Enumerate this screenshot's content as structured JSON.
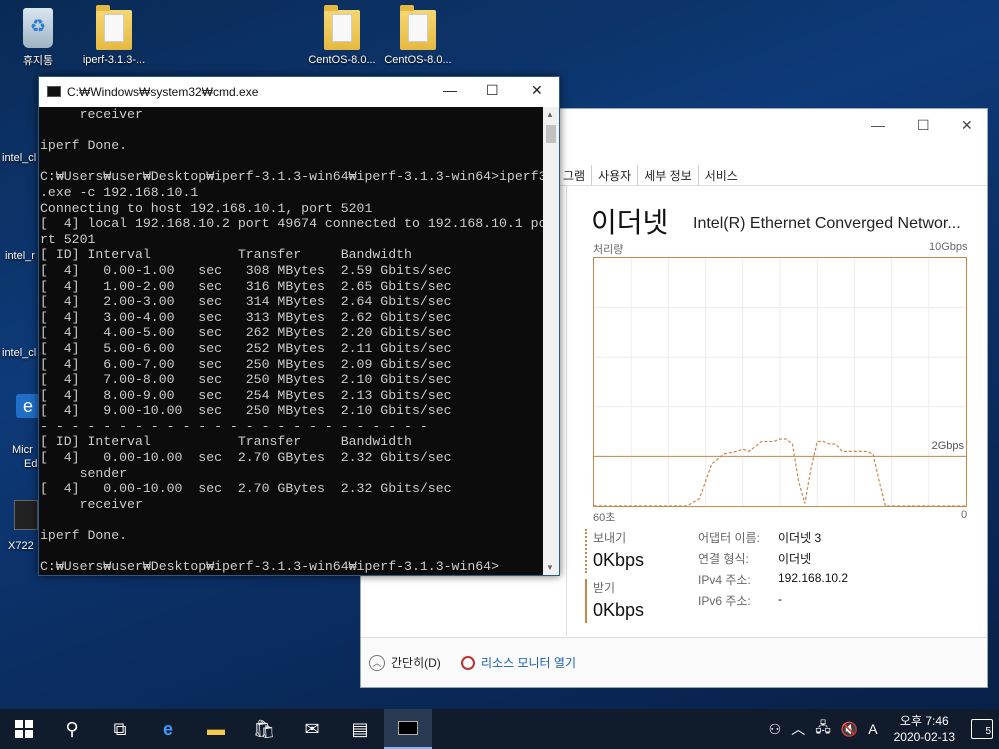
{
  "desktop": {
    "icons": [
      {
        "label": "휴지통"
      },
      {
        "label": "iperf-3.1.3-..."
      },
      {
        "label": "CentOS-8.0..."
      },
      {
        "label": "CentOS-8.0..."
      }
    ],
    "partial_labels": [
      "intel_cl",
      "intel_r",
      "intel_cl",
      "Micr",
      "Ed",
      "X722"
    ]
  },
  "cmd": {
    "title": "C:₩Windows₩system32₩cmd.exe",
    "lines": [
      "     receiver",
      "",
      "iperf Done.",
      "",
      "C:₩Users₩user₩Desktop₩iperf-3.1.3-win64₩iperf-3.1.3-win64>iperf3",
      ".exe -c 192.168.10.1",
      "Connecting to host 192.168.10.1, port 5201",
      "[  4] local 192.168.10.2 port 49674 connected to 192.168.10.1 po",
      "rt 5201",
      "[ ID] Interval           Transfer     Bandwidth",
      "[  4]   0.00-1.00   sec   308 MBytes  2.59 Gbits/sec",
      "[  4]   1.00-2.00   sec   316 MBytes  2.65 Gbits/sec",
      "[  4]   2.00-3.00   sec   314 MBytes  2.64 Gbits/sec",
      "[  4]   3.00-4.00   sec   313 MBytes  2.62 Gbits/sec",
      "[  4]   4.00-5.00   sec   262 MBytes  2.20 Gbits/sec",
      "[  4]   5.00-6.00   sec   252 MBytes  2.11 Gbits/sec",
      "[  4]   6.00-7.00   sec   250 MBytes  2.09 Gbits/sec",
      "[  4]   7.00-8.00   sec   250 MBytes  2.10 Gbits/sec",
      "[  4]   8.00-9.00   sec   254 MBytes  2.13 Gbits/sec",
      "[  4]   9.00-10.00  sec   250 MBytes  2.10 Gbits/sec",
      "- - - - - - - - - - - - - - - - - - - - - - - - -",
      "[ ID] Interval           Transfer     Bandwidth",
      "[  4]   0.00-10.00  sec  2.70 GBytes  2.32 Gbits/sec",
      "     sender",
      "[  4]   0.00-10.00  sec  2.70 GBytes  2.32 Gbits/sec",
      "     receiver",
      "",
      "iperf Done.",
      "",
      "C:₩Users₩user₩Desktop₩iperf-3.1.3-win64₩iperf-3.1.3-win64>"
    ]
  },
  "taskmgr": {
    "tabs": [
      "그램",
      "사용자",
      "세부 정보",
      "서비스"
    ],
    "heading": "이더넷",
    "adapter": "Intel(R) Ethernet Converged Networ...",
    "throughput_label": "처리량",
    "max_label": "10Gbps",
    "mid_label": "2Gbps",
    "x_left": "60초",
    "x_right": "0",
    "send_label": "보내기",
    "send_value": "0Kbps",
    "recv_label": "받기",
    "recv_value": "0Kbps",
    "info": [
      {
        "k": "어댑터 이름:",
        "v": "이더넷 3"
      },
      {
        "k": "연결 형식:",
        "v": "이더넷"
      },
      {
        "k": "IPv4 주소:",
        "v": "192.168.10.2"
      },
      {
        "k": "IPv6 주소:",
        "v": "-"
      }
    ],
    "footer_simple": "간단히(D)",
    "footer_resmon": "리소스 모니터 열기"
  },
  "chart_data": {
    "type": "line",
    "ylim": [
      0,
      10
    ],
    "x": [
      60,
      50,
      45,
      43,
      41,
      39,
      37,
      36,
      35,
      34,
      33,
      32,
      31,
      30,
      29,
      28,
      27,
      26,
      25,
      24,
      23,
      22,
      21,
      20,
      19,
      18,
      17,
      16,
      15,
      14,
      13,
      12,
      11,
      10,
      0
    ],
    "series": [
      {
        "values": [
          0,
          0,
          0,
          0.3,
          1.7,
          2.1,
          2.2,
          2.3,
          2.2,
          2.4,
          2.6,
          2.6,
          2.6,
          2.7,
          2.7,
          2.5,
          1.0,
          0.1,
          1.5,
          2.6,
          2.6,
          2.5,
          2.5,
          2.2,
          2.2,
          2.2,
          2.2,
          2.2,
          2.1,
          1.0,
          0,
          0,
          0,
          0,
          0
        ]
      }
    ]
  },
  "taskbar": {
    "time": "오후 7:46",
    "date": "2020-02-13",
    "notif_count": "5",
    "ime": "A"
  }
}
